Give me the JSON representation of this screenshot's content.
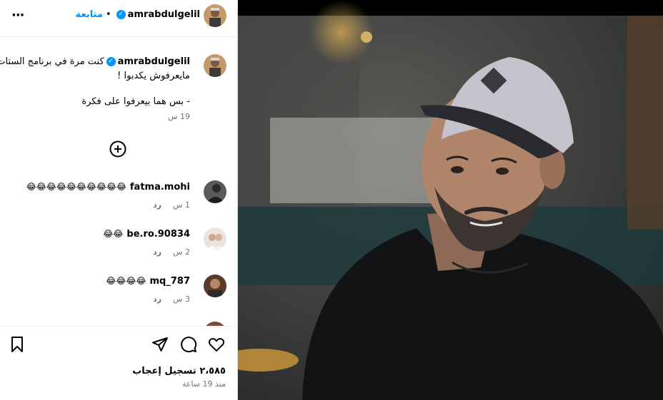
{
  "header": {
    "username": "amrabdulgelil",
    "follow_label": "متابعة",
    "dot": "•",
    "more": "···"
  },
  "caption": {
    "username": "amrabdulgelil",
    "line1": "كنت مرة في برنامج الستات",
    "line2": "مايعرفوش يكدبوا !",
    "line3": "- بس هما بيعرفوا على فكرة",
    "time": "19 س"
  },
  "comments": [
    {
      "username": "fatma.mohi",
      "text": "😂😂😂😂😂😂😂😂😂😂",
      "time": "1 س",
      "reply": "رد"
    },
    {
      "username": "be.ro.90834",
      "text": "😂😂",
      "time": "2 س",
      "reply": "رد"
    },
    {
      "username": "mq_787",
      "text": "😂😂😂😂",
      "time": "3 س",
      "reply": "رد"
    }
  ],
  "actions": {
    "likes": "٢،٥٨٥ تسجيل إعجاب",
    "posted": "منذ 19 ساعة"
  },
  "colors": {
    "accent": "#0095f6",
    "border": "#dbdbdb",
    "muted": "#737373"
  }
}
